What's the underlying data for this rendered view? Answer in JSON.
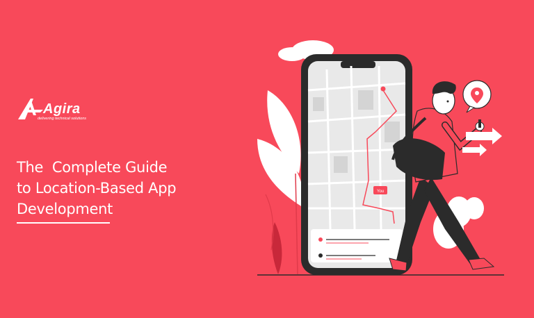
{
  "brand": {
    "name": "Agira",
    "tagline": "delivering technical solutions"
  },
  "headline": {
    "line1": "The  Complete Guide",
    "line2": "to Location-Based App",
    "line3": "Development"
  },
  "illustration": {
    "map_marker_label": "You",
    "icons": [
      "location-pin-icon",
      "arrow-right-icon",
      "smartphone",
      "map"
    ]
  },
  "colors": {
    "background": "#f8495a",
    "accent_dark": "#2b2b2b",
    "white": "#ffffff"
  }
}
